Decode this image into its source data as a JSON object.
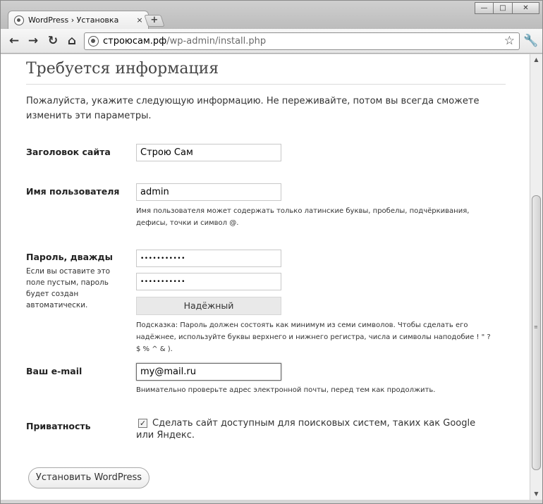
{
  "browser": {
    "tab_title": "WordPress › Установка",
    "tab_close": "×",
    "new_tab": "+",
    "url_host": "строюсам.рф",
    "url_path": "/wp-admin/install.php",
    "window_controls": {
      "minimize": "—",
      "maximize": "□",
      "close": "✕"
    }
  },
  "page": {
    "title": "Требуется информация",
    "intro": "Пожалуйста, укажите следующую информацию. Не переживайте, потом вы всегда сможете изменить эти параметры."
  },
  "form": {
    "site_title": {
      "label": "Заголовок сайта",
      "value": "Строю Сам"
    },
    "username": {
      "label": "Имя пользователя",
      "value": "admin",
      "hint": "Имя пользователя может содержать только латинские буквы, пробелы, подчёркивания, дефисы, точки и символ @."
    },
    "password": {
      "label": "Пароль, дважды",
      "sub": "Если вы оставите это поле пустым, пароль будет создан автоматически.",
      "value1": "•••••••••••",
      "value2": "•••••••••••",
      "strength": "Надёжный",
      "hint": "Подсказка: Пароль должен состоять как минимум из семи символов. Чтобы сделать его надёжнее, используйте буквы верхнего и нижнего регистра, числа и символы наподобие ! \" ? $ % ^ & )."
    },
    "email": {
      "label": "Ваш e-mail",
      "value": "my@mail.ru",
      "hint": "Внимательно проверьте адрес электронной почты, перед тем как продолжить."
    },
    "privacy": {
      "label": "Приватность",
      "checked": true,
      "check_mark": "✓",
      "check_label": "Сделать сайт доступным для поисковых систем, таких как Google или Яндекс."
    },
    "submit_label": "Установить WordPress"
  }
}
